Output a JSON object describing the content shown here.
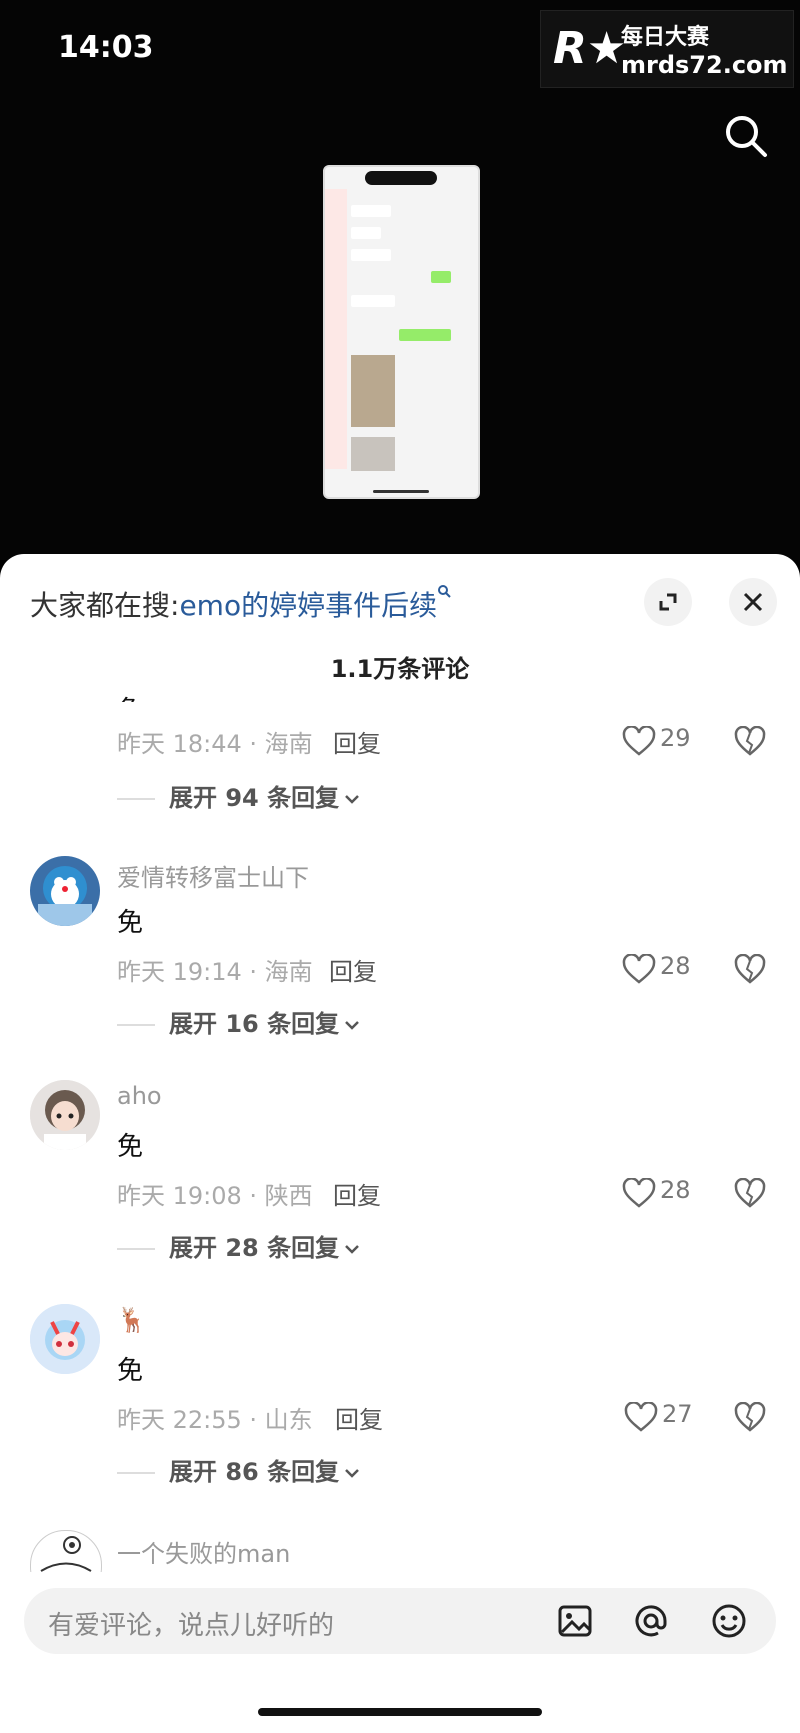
{
  "status": {
    "time": "14:03"
  },
  "watermark": {
    "title": "每日大赛",
    "url": "mrds72.com"
  },
  "search_bar": {
    "prefix": "大家都在搜:",
    "query": "emo的婷婷事件后续"
  },
  "comments_count": "1.1万条评论",
  "comments": [
    {
      "meta": "昨天 18:44 · 海南",
      "reply": "回复",
      "likes": "29",
      "expand": "展开 94 条回复"
    },
    {
      "user": "爱情转移富士山下",
      "text": "免",
      "meta": "昨天 19:14 · 海南",
      "reply": "回复",
      "likes": "28",
      "expand": "展开 16 条回复"
    },
    {
      "user": "aho",
      "text": "免",
      "meta": "昨天 19:08 · 陕西",
      "reply": "回复",
      "likes": "28",
      "expand": "展开 28 条回复"
    },
    {
      "user": "🦌",
      "text": "免",
      "meta": "昨天 22:55 · 山东",
      "reply": "回复",
      "likes": "27",
      "expand": "展开 86 条回复"
    },
    {
      "user": "一个失败的man"
    }
  ],
  "input": {
    "placeholder": "有爱评论，说点儿好听的"
  },
  "icons": [
    "search-icon",
    "expand-icon",
    "close-icon",
    "heart-icon",
    "broken-heart-icon",
    "image-icon",
    "at-icon",
    "emoji-icon",
    "chevron-down-icon"
  ]
}
